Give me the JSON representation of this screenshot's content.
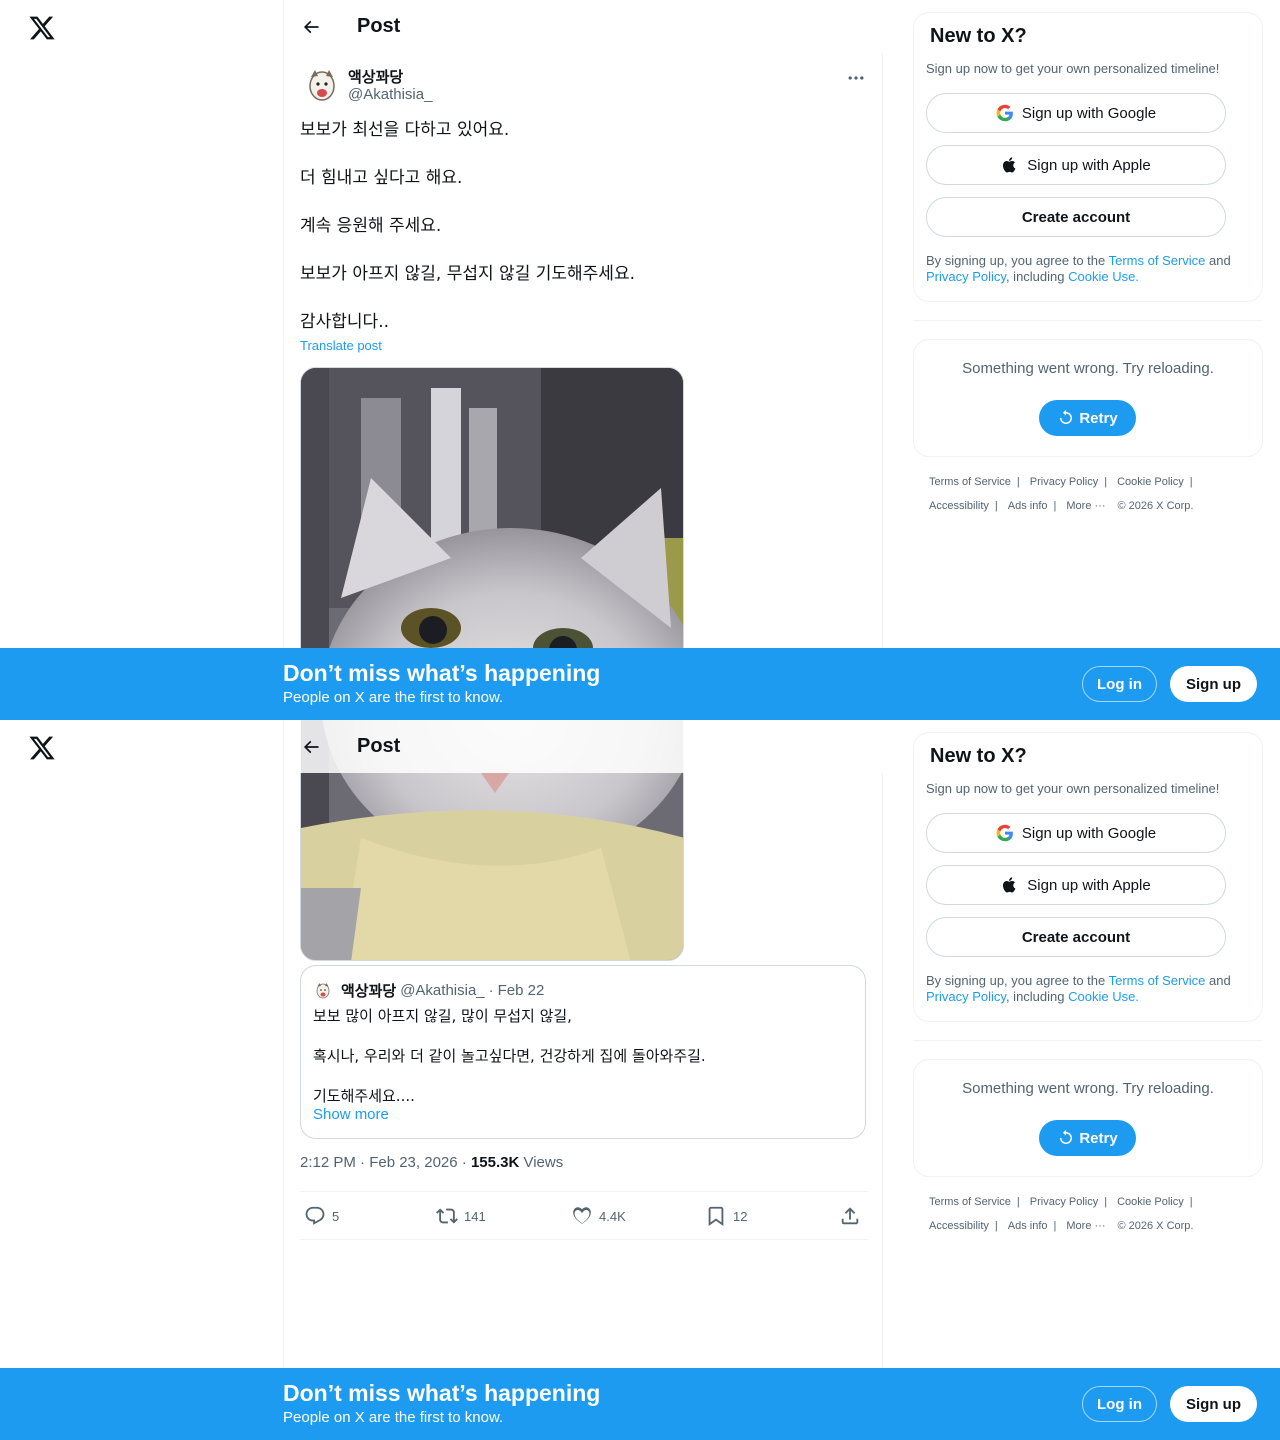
{
  "header": {
    "title": "Post"
  },
  "tweet": {
    "author_name": "액상꽈당",
    "author_handle": "@Akathisia_",
    "lines": [
      "보보가 최선을 다하고 있어요.",
      "더 힘내고 싶다고 해요.",
      "계속 응원해 주세요.",
      "보보가 아프지 않길, 무섭지 않길 기도해주세요.",
      "감사합니다.."
    ],
    "translate_label": "Translate post",
    "timestamp": "2:12 PM · Feb 23, 2026 · ",
    "views_count": "155.3K",
    "views_label": " Views",
    "replies": "5",
    "reposts": "141",
    "likes": "4.4K",
    "bookmarks": "12"
  },
  "quote": {
    "author_name": "액상꽈당",
    "author_handle": "@Akathisia_",
    "separator": "·",
    "date": "Feb 22",
    "lines": [
      "보보 많이 아프지 않길, 많이 무섭지 않길,",
      "혹시나, 우리와 더 같이 놀고싶다면, 건강하게 집에 돌아와주길.",
      "기도해주세요...."
    ],
    "show_more": "Show more"
  },
  "sidebar": {
    "signup_title": "New to X?",
    "signup_subtitle": "Sign up now to get your own personalized timeline!",
    "google_label": "Sign up with Google",
    "apple_label": "Sign up with Apple",
    "create_label": "Create account",
    "terms_prefix": "By signing up, you agree to the ",
    "terms_link": "Terms of Service",
    "terms_and": " and ",
    "privacy_link": "Privacy Policy",
    "terms_including": ", including ",
    "cookie_link": "Cookie Use.",
    "error_message": "Something went wrong. Try reloading.",
    "retry_label": "Retry"
  },
  "footer": {
    "links": [
      "Terms of Service",
      "Privacy Policy",
      "Cookie Policy",
      "Accessibility",
      "Ads info",
      "More ···"
    ],
    "separator": "|",
    "copyright": "© 2026 X Corp."
  },
  "banner": {
    "title": "Don’t miss what’s happening",
    "subtitle": "People on X are the first to know.",
    "login_label": "Log in",
    "signup_label": "Sign up"
  },
  "colors": {
    "accent": "#1d9bf0",
    "text": "#0f1419",
    "muted": "#536471",
    "border": "#cfd9de"
  },
  "icons": [
    "x-logo-icon",
    "back-arrow-icon",
    "more-icon",
    "reply-icon",
    "repost-icon",
    "like-icon",
    "bookmark-icon",
    "share-icon",
    "google-icon",
    "apple-icon",
    "refresh-icon"
  ]
}
